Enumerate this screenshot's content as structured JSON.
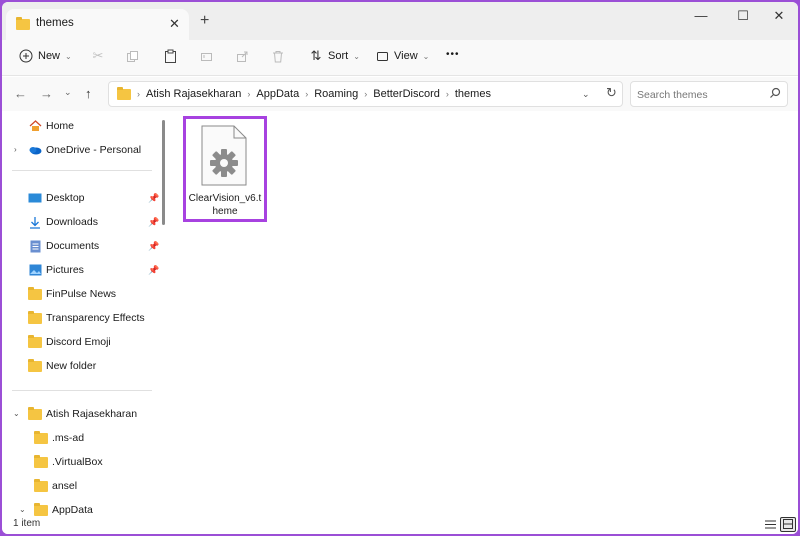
{
  "window": {
    "tab_title": "themes",
    "new_tab": "+",
    "minimize": "—",
    "maximize": "☐",
    "close": "✕"
  },
  "toolbar": {
    "new_label": "New",
    "sort_label": "Sort",
    "view_label": "View",
    "more_label": "•••"
  },
  "address": {
    "crumbs": [
      "Atish Rajasekharan",
      "AppData",
      "Roaming",
      "BetterDiscord",
      "themes"
    ]
  },
  "search": {
    "placeholder": "Search themes"
  },
  "sidebar": {
    "quick": [
      {
        "label": "Home"
      },
      {
        "label": "OneDrive - Personal"
      }
    ],
    "pinned": [
      {
        "label": "Desktop",
        "icon": "desktop-icon"
      },
      {
        "label": "Downloads",
        "icon": "download-icon"
      },
      {
        "label": "Documents",
        "icon": "documents-icon"
      },
      {
        "label": "Pictures",
        "icon": "pictures-icon"
      }
    ],
    "folders": [
      {
        "label": "FinPulse News"
      },
      {
        "label": "Transparency Effects"
      },
      {
        "label": "Discord Emoji"
      },
      {
        "label": "New folder"
      }
    ],
    "tree": [
      {
        "label": "Atish Rajasekharan"
      },
      {
        "label": ".ms-ad"
      },
      {
        "label": ".VirtualBox"
      },
      {
        "label": "ansel"
      },
      {
        "label": "AppData"
      }
    ]
  },
  "files": [
    {
      "name": "ClearVision_v6.theme",
      "icon": "gear-icon"
    }
  ],
  "status": {
    "item_count": "1 item"
  },
  "colors": {
    "highlight": "#a742e0",
    "folder": "#f5c542",
    "accent": "#0067c0"
  }
}
